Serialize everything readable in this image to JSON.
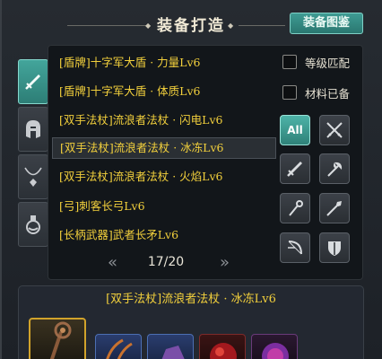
{
  "header": {
    "title": "装备打造",
    "atlas_button": "装备图鉴"
  },
  "tabs": [
    {
      "icon": "sword-icon",
      "active": true
    },
    {
      "icon": "helmet-icon",
      "active": false
    },
    {
      "icon": "necklace-icon",
      "active": false
    },
    {
      "icon": "potion-icon",
      "active": false
    }
  ],
  "recipes": [
    "[盾牌]十字军大盾 · 力量Lv6",
    "[盾牌]十字军大盾 · 体质Lv6",
    "[双手法杖]流浪者法杖 · 闪电Lv6",
    "[双手法杖]流浪者法杖 · 冰冻Lv6",
    "[双手法杖]流浪者法杖 · 火焰Lv6",
    "[弓]刺客长弓Lv6",
    "[长柄武器]武者长矛Lv6"
  ],
  "selected_index": 3,
  "filters": {
    "match_level": "等级匹配",
    "materials_ready": "材料已备",
    "all": "All",
    "buttons": [
      "crossed-swords-icon",
      "sword-icon",
      "axe-icon",
      "staff-icon",
      "spear-icon",
      "bow-icon",
      "shield-icon"
    ]
  },
  "pager": {
    "prev": "«",
    "text": "17/20",
    "next": "»"
  },
  "detail": {
    "title": "[双手法杖]流浪者法杖 · 冰冻Lv6"
  },
  "colors": {
    "accent": "#3e9b93",
    "item_text": "#f1cf3c"
  }
}
